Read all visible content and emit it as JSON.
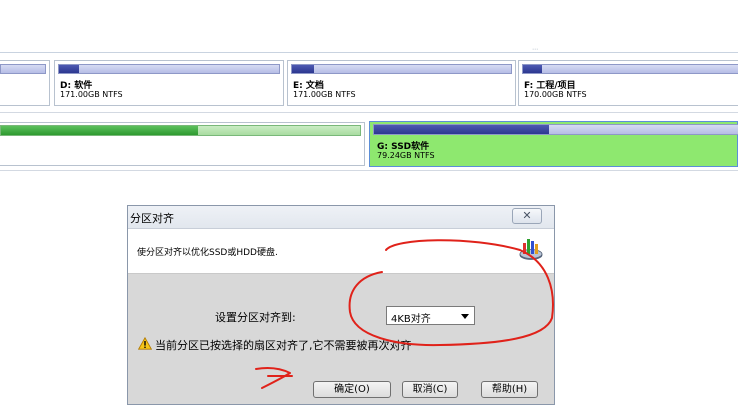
{
  "disk_map": {
    "partitions_row1": [
      {
        "name": "D: 软件",
        "info": "171.00GB NTFS",
        "used_fraction": 0.09
      },
      {
        "name": "E: 文档",
        "info": "171.00GB NTFS",
        "used_fraction": 0.1
      },
      {
        "name": "F: 工程/项目",
        "info": "170.00GB NTFS",
        "used_fraction": 0.09
      }
    ],
    "partition_green": {
      "used_fraction": 0.55
    },
    "partition_g": {
      "name": "G: SSD软件",
      "info": "79.24GB NTFS",
      "used_fraction": 0.48,
      "selected": true
    },
    "overflow_dots": "⋯"
  },
  "dialog": {
    "title": "分区对齐",
    "close_label": "✕",
    "description": "使分区对齐以优化SSD或HDD硬盘.",
    "header_icon": "disk-chart-icon",
    "set_label": "设置分区对齐到:",
    "alignment_select": {
      "value": "4KB对齐"
    },
    "warning_icon": "warning-icon",
    "warning_text": "当前分区已按选择的扇区对齐了,它不需要被再次对齐",
    "buttons": {
      "ok": "确定(O)",
      "cancel": "取消(C)",
      "help": "帮助(H)"
    }
  },
  "colors": {
    "annotation_red": "#e0221a",
    "selected_partition": "#8ee86f",
    "used_space_blue": "#2c3790",
    "used_space_green": "#2f9a30"
  }
}
